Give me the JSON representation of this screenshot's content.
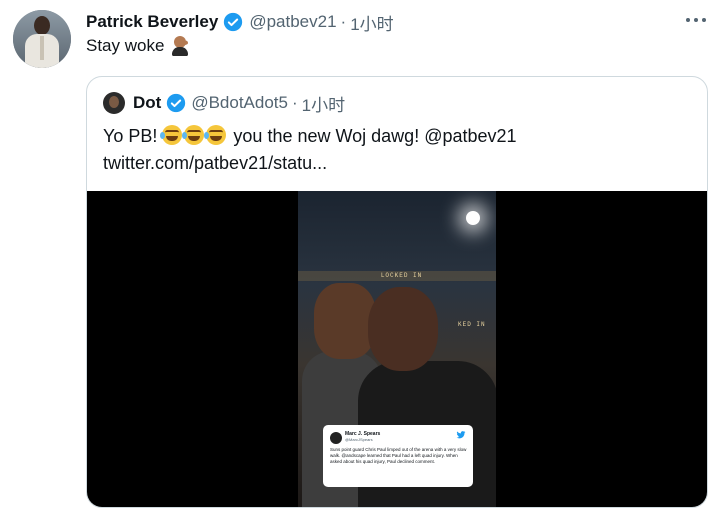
{
  "tweet": {
    "name": "Patrick Beverley",
    "handle": "@patbev21",
    "separator": "·",
    "time": "1小时",
    "text": "Stay woke",
    "text_emoji": "man-facepalming-emoji"
  },
  "quoted": {
    "name": "Dot",
    "handle": "@BdotAdot5",
    "separator": "·",
    "time": "1小时",
    "line1_start": "Yo PB!",
    "line1_emojis": [
      "face-with-tears-of-joy",
      "face-with-tears-of-joy",
      "face-with-tears-of-joy"
    ],
    "line1_end": "you the new Woj dawg! @patbev21",
    "line2": "twitter.com/patbev21/statu..."
  },
  "video": {
    "banner_text": "LOCKED IN",
    "banner_text2": "KED IN",
    "embedded_tweet": {
      "name": "Marc J. Spears",
      "handle": "@MarcJSpears",
      "text": "Suns point guard Chris Paul limped out of the arena with a very slow walk. @andscape learned that Paul had a left quad injury. When asked about his quad injury, Paul declined comment."
    }
  },
  "colors": {
    "verified": "#1d9bf0",
    "secondary_text": "#536471",
    "border": "#cfd9de"
  },
  "icons": {
    "verified": "verified-badge-icon",
    "more": "more-horizontal-icon"
  }
}
